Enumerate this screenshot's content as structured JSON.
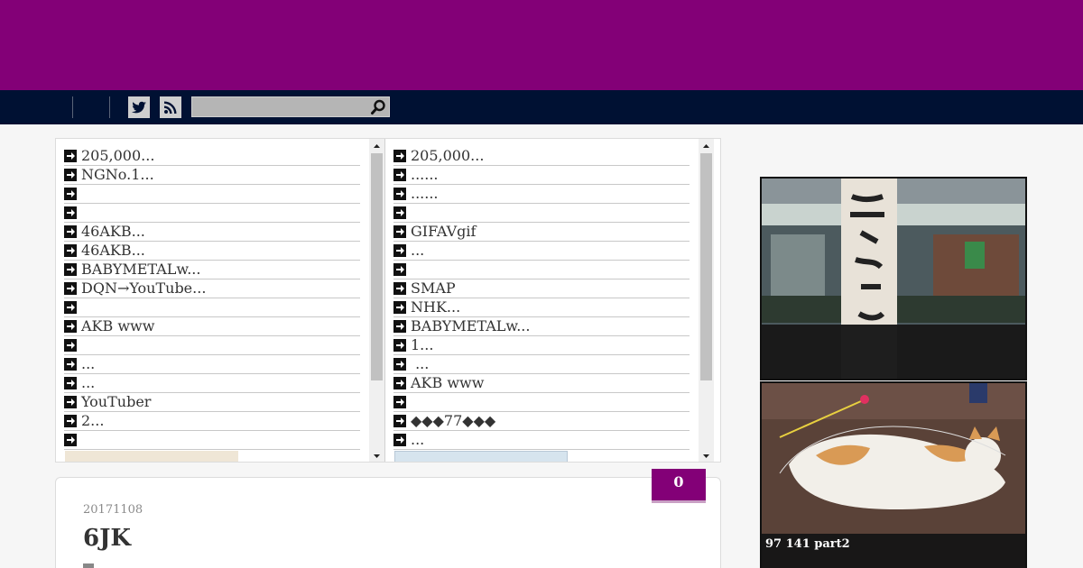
{
  "search": {
    "placeholder": ""
  },
  "feeds": {
    "left": {
      "items": [
        "205,000...",
        "NGNo.1...",
        "",
        "",
        "46AKB...",
        "46AKB...",
        "BABYMETALw...",
        "DQN→YouTube...",
        "",
        "AKB www",
        "",
        "...",
        "...",
        "YouTuber",
        "2...",
        ""
      ]
    },
    "right": {
      "items": [
        "205,000...",
        "......",
        "......",
        "",
        "GIFAVgif",
        "...",
        "",
        "SMAP",
        "NHK...",
        "BABYMETALw...",
        "1...",
        " ...",
        "AKB www",
        "",
        "◆◆◆77◆◆◆",
        "..."
      ]
    }
  },
  "post": {
    "comment_count": "0",
    "date": "20171108",
    "title": "6JK"
  },
  "sidebar": {
    "cards": [
      {
        "caption": ""
      },
      {
        "caption": "97 141 part2"
      }
    ]
  },
  "colors": {
    "brand": "#830077",
    "nav": "#001133"
  }
}
